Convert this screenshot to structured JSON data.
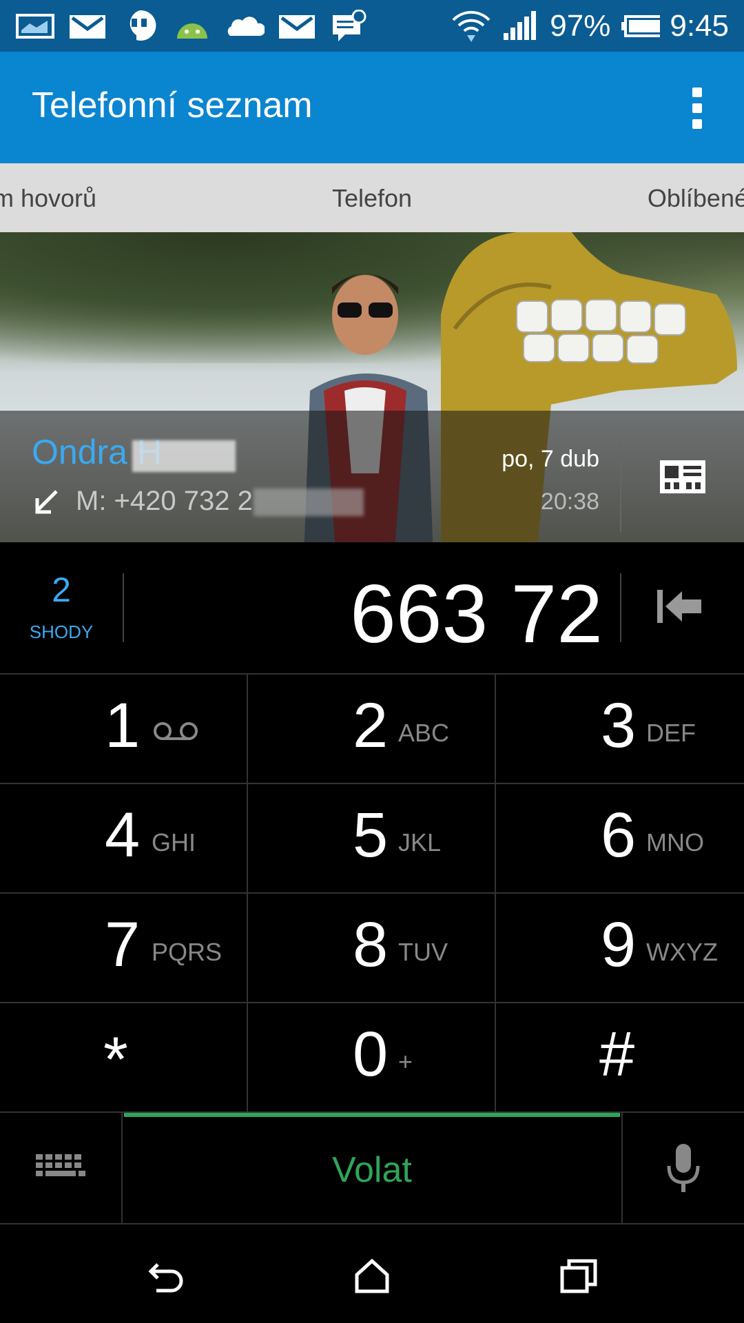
{
  "status_bar": {
    "battery_percent": "97%",
    "time": "9:45",
    "icons": [
      "image-icon",
      "gmail-icon",
      "hangouts-icon",
      "android-icon",
      "cloud-icon",
      "gmail-icon",
      "message-icon",
      "wifi-icon",
      "signal-icon",
      "battery-icon"
    ]
  },
  "app_bar": {
    "title": "Telefonní seznam",
    "more_icon": "more-vert-icon"
  },
  "tabs": {
    "left": "m hovorů",
    "center": "Telefon",
    "right": "Oblíbené"
  },
  "contact": {
    "name": "Ondra H",
    "number": "M: +420 732 2",
    "date": "po, 7 dub",
    "time": "20:38"
  },
  "dialer": {
    "matches_count": "2",
    "matches_label": "SHODY",
    "number": "663 72"
  },
  "keypad": [
    {
      "digit": "1",
      "letters": ""
    },
    {
      "digit": "2",
      "letters": "ABC"
    },
    {
      "digit": "3",
      "letters": "DEF"
    },
    {
      "digit": "4",
      "letters": "GHI"
    },
    {
      "digit": "5",
      "letters": "JKL"
    },
    {
      "digit": "6",
      "letters": "MNO"
    },
    {
      "digit": "7",
      "letters": "PQRS"
    },
    {
      "digit": "8",
      "letters": "TUV"
    },
    {
      "digit": "9",
      "letters": "WXYZ"
    },
    {
      "digit": "*",
      "letters": ""
    },
    {
      "digit": "0",
      "letters": "+"
    },
    {
      "digit": "#",
      "letters": ""
    }
  ],
  "actions": {
    "call_label": "Volat"
  },
  "colors": {
    "status_bar": "#0a5c93",
    "app_bar": "#0a85d0",
    "accent_blue": "#3aaaf0",
    "call_green": "#2fa55a"
  }
}
